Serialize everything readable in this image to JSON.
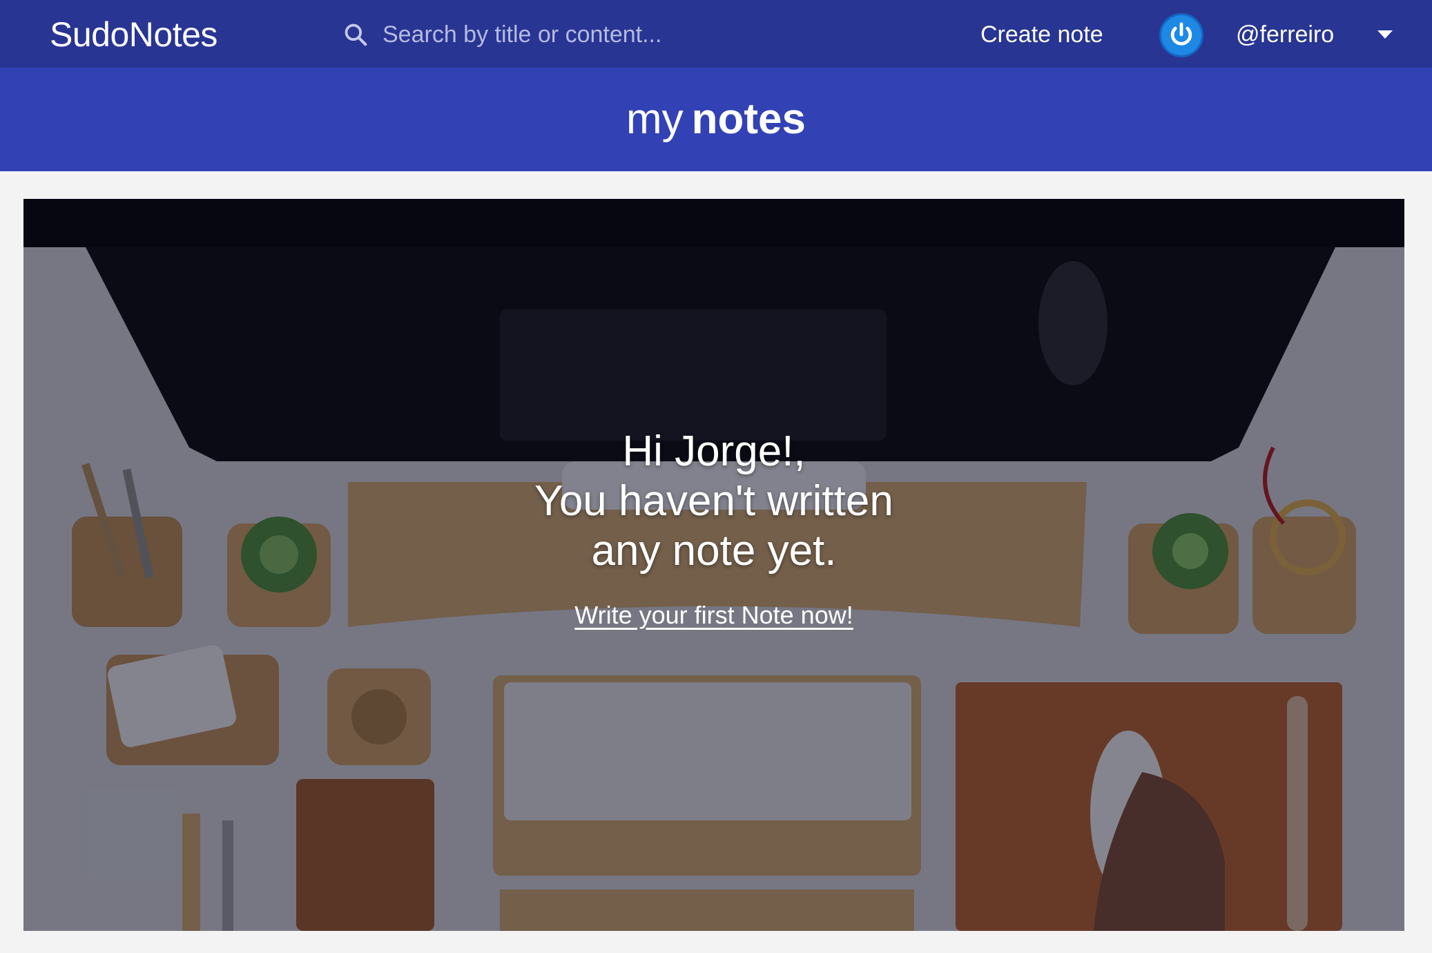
{
  "header": {
    "brand": "SudoNotes",
    "search_placeholder": "Search by title or content...",
    "create_note_label": "Create note",
    "username": "@ferreiro",
    "icons": {
      "search": "search-icon",
      "power": "power-icon",
      "dropdown": "caret-down-icon"
    }
  },
  "title_band": {
    "title_light": "my",
    "title_bold": "notes"
  },
  "hero": {
    "line1": "Hi Jorge!,",
    "line2": "You haven't written",
    "line3": "any note yet.",
    "cta_label": "Write your first Note now!"
  },
  "colors": {
    "topbar": "#283593",
    "title_band": "#3242b5",
    "page_background": "#f3f3f3",
    "accent_power": "#1e88e5"
  }
}
